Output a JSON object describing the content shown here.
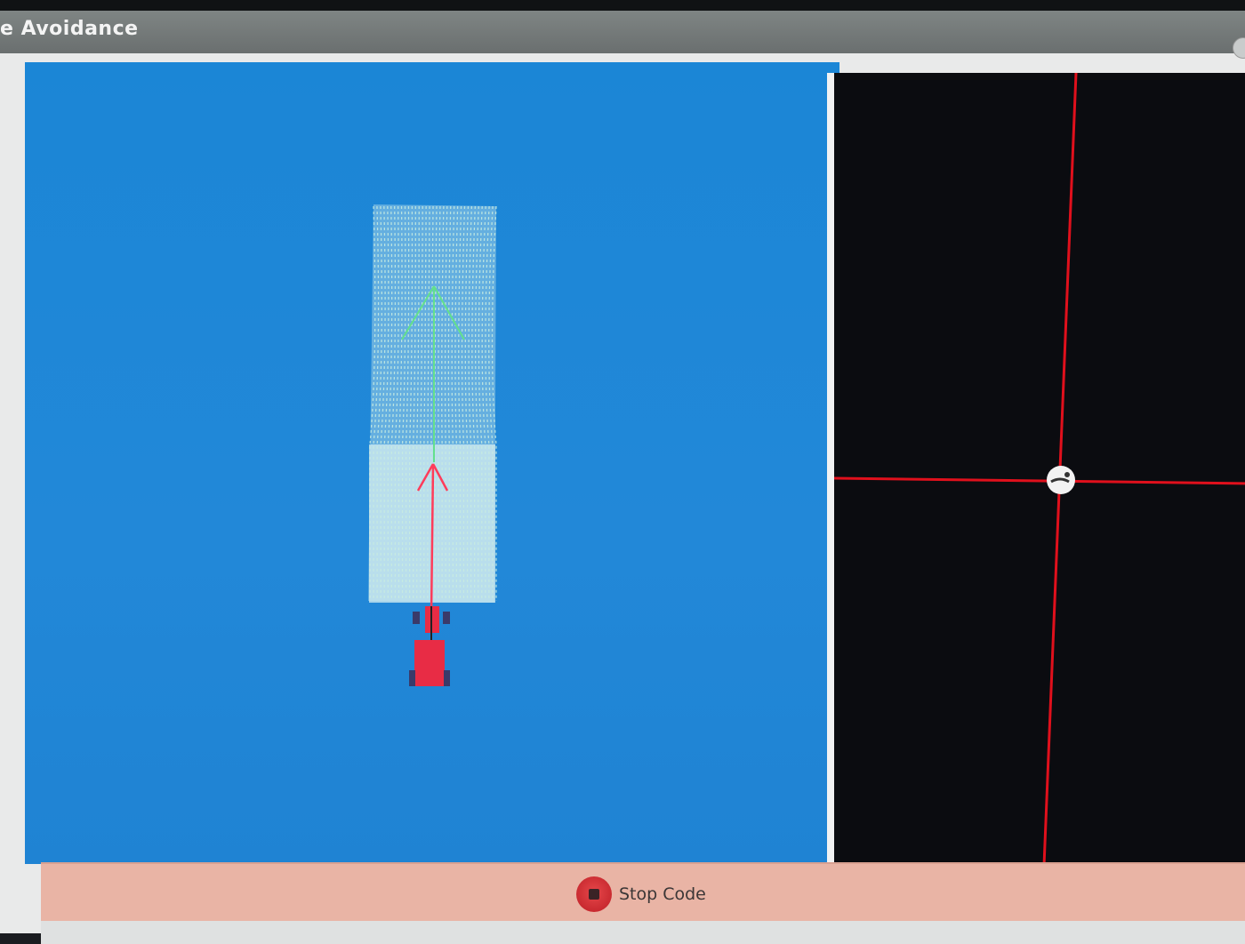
{
  "window": {
    "title": "e Avoidance"
  },
  "controls": {
    "stop_label": "Stop Code"
  },
  "icons": {
    "stop": "stop-icon",
    "robot": "robot-icon",
    "target_ball": "ball-icon"
  },
  "colors": {
    "sim_background": "#1f86d6",
    "robot": "#e82c45",
    "force_field": "#bfe7df",
    "goal_arrow": "#63e08c",
    "velocity_arrow": "#ff3c5a",
    "crosshair": "#e0101c",
    "stop_bar": "#e9b4a5"
  }
}
